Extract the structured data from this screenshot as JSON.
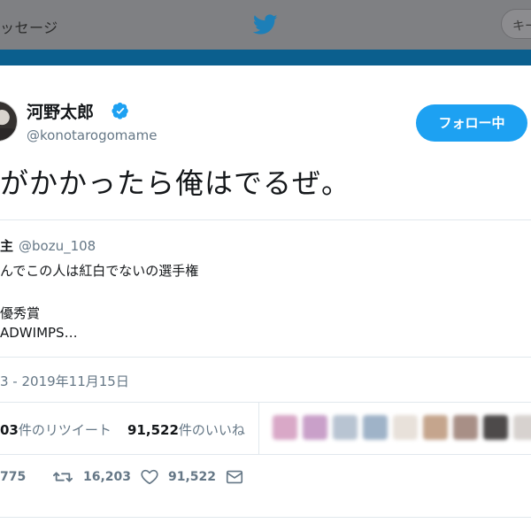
{
  "topnav": {
    "messages_label": "ッセージ",
    "search_placeholder": "キー"
  },
  "tweet": {
    "display_name": "河野太郎",
    "screen_name": "@konotarogomame",
    "follow_label": "フォロー中",
    "text": "がかかったら俺はでるぜ。",
    "timestamp": "3 - 2019年11月15日"
  },
  "quote": {
    "author_name": "主",
    "author_handle": "@bozu_108",
    "lines": [
      "んでこの人は紅白でないの選手権",
      "",
      "優秀賞",
      "ADWIMPS…"
    ]
  },
  "stats": {
    "retweet_count": "03",
    "retweet_label": "件のリツイート",
    "like_count": "91,522",
    "like_label": "件のいいね"
  },
  "actions": {
    "reply_count": "775",
    "retweet_count": "16,203",
    "like_count": "91,522"
  },
  "likers": [
    {
      "color": "#d9a8c7"
    },
    {
      "color": "#c9a0c9"
    },
    {
      "color": "#b8c4d2"
    },
    {
      "color": "#9fb3c8"
    },
    {
      "color": "#e8e1da"
    },
    {
      "color": "#c5a58d"
    },
    {
      "color": "#a88f86"
    },
    {
      "color": "#4d4a4a"
    },
    {
      "color": "#d7d2cf"
    }
  ],
  "colors": {
    "accent": "#1da1f2",
    "muted": "#657786",
    "border": "#e1e8ed",
    "nav_band": "#0b5f8e"
  }
}
